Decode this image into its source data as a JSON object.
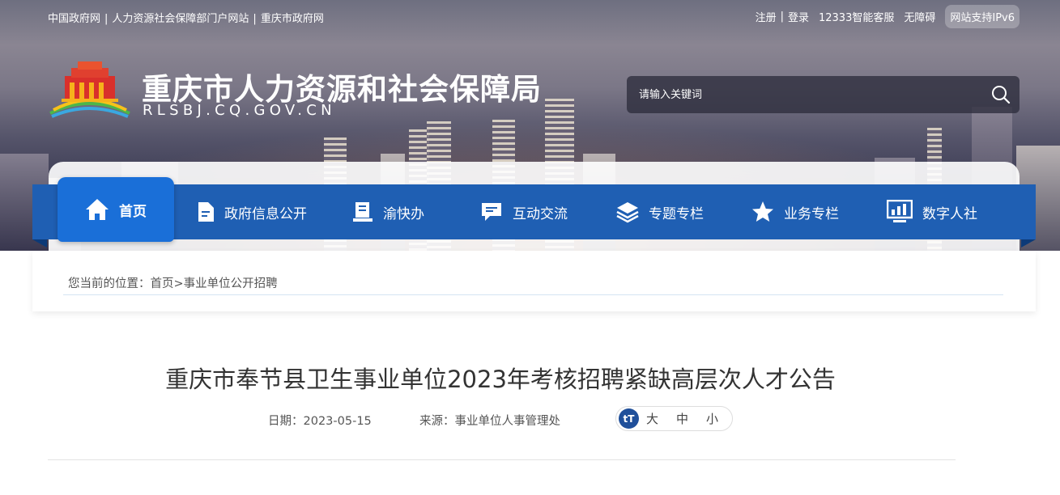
{
  "top_links": [
    "中国政府网",
    "人力资源社会保障部门户网站",
    "重庆市政府网"
  ],
  "top_right": {
    "register": "注册",
    "login": "登录",
    "service": "12333智能客服",
    "accessible": "无障碍",
    "ipv6": "网站支持IPv6"
  },
  "site": {
    "title": "重庆市人力资源和社会保障局",
    "domain": "RLSBJ.CQ.GOV.CN"
  },
  "search": {
    "placeholder": "请输入关键词",
    "icon": "search-icon"
  },
  "nav": [
    {
      "label": "首页",
      "icon": "home-icon",
      "active": true
    },
    {
      "label": "政府信息公开",
      "icon": "document-icon"
    },
    {
      "label": "渝快办",
      "icon": "book-icon"
    },
    {
      "label": "互动交流",
      "icon": "chat-icon"
    },
    {
      "label": "专题专栏",
      "icon": "layers-icon"
    },
    {
      "label": "业务专栏",
      "icon": "star-icon"
    },
    {
      "label": "数字人社",
      "icon": "monitor-chart-icon"
    }
  ],
  "breadcrumb": {
    "prefix": "您当前的位置：",
    "home": "首页",
    "sep": ">",
    "current": "事业单位公开招聘"
  },
  "article": {
    "title": "重庆市奉节县卫生事业单位2023年考核招聘紧缺高层次人才公告",
    "date_label": "日期：",
    "date": "2023-05-15",
    "source_label": "来源：",
    "source": "事业单位人事管理处",
    "font_icon": "tT",
    "font_sizes": [
      "大",
      "中",
      "小"
    ]
  },
  "colors": {
    "nav_bg": "#1f5fb3",
    "nav_active": "#1a6fd8",
    "font_icon_bg": "#1f4f9a"
  }
}
